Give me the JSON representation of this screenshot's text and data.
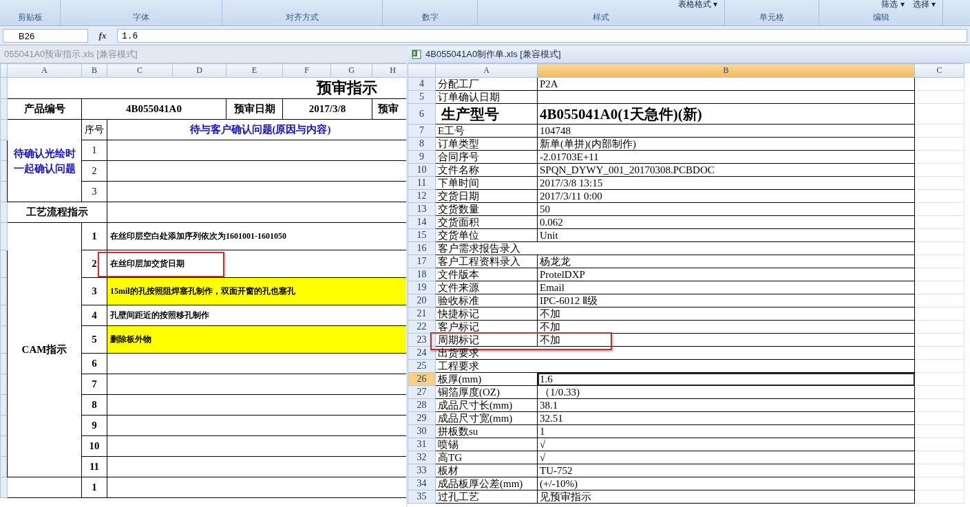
{
  "ribbon": {
    "groups": [
      {
        "label": "剪贴板"
      },
      {
        "label": "字体"
      },
      {
        "label": "对齐方式"
      },
      {
        "label": "数字"
      },
      {
        "label": "样式",
        "commands": [
          "表格格式 ▾"
        ]
      },
      {
        "label": "单元格"
      },
      {
        "label": "编辑",
        "commands": [
          "筛选 ▾",
          "选择 ▾"
        ]
      }
    ]
  },
  "formula_bar": {
    "name_box": "B26",
    "function_label": "fx",
    "value": "1.6"
  },
  "left_window": {
    "title": "055041A0预审指示.xls  [兼容模式]",
    "active": false,
    "columns": [
      "A",
      "B",
      "C",
      "D",
      "E",
      "F",
      "G",
      "H"
    ],
    "sheet_title": "预审指示",
    "info": [
      "产品编号",
      "4B055041A0",
      "预审日期",
      "2017/3/8",
      "预审"
    ],
    "confirm": {
      "label": "待确认光绘时一起确认问题",
      "number_header": "序号",
      "content_header": "待与客户确认问题(原因与内容)",
      "numbers": [
        "1",
        "2",
        "3"
      ]
    },
    "process_label": "工艺流程指示",
    "cam": {
      "label": "CAM指示",
      "rows": [
        {
          "number": "1",
          "text": "在丝印层空白处添加序列依次为1601001-1601050",
          "highlight": false,
          "marked": false
        },
        {
          "number": "2",
          "text": "在丝印层加交货日期",
          "highlight": false,
          "marked": true
        },
        {
          "number": "3",
          "text": "15mil的孔按照阻焊塞孔制作，双面开窗的孔也塞孔",
          "highlight": true,
          "marked": false
        },
        {
          "number": "4",
          "text": "孔壁间距近的按照移孔制作",
          "highlight": false,
          "marked": false
        },
        {
          "number": "5",
          "text": "删除板外物",
          "highlight": true,
          "marked": false
        },
        {
          "number": "6",
          "text": "",
          "highlight": false,
          "marked": false
        },
        {
          "number": "7",
          "text": "",
          "highlight": false,
          "marked": false
        },
        {
          "number": "8",
          "text": "",
          "highlight": false,
          "marked": false
        },
        {
          "number": "9",
          "text": "",
          "highlight": false,
          "marked": false
        },
        {
          "number": "10",
          "text": "",
          "highlight": false,
          "marked": false
        },
        {
          "number": "11",
          "text": "",
          "highlight": false,
          "marked": false
        }
      ]
    },
    "next_numbers": [
      "1"
    ]
  },
  "right_window": {
    "title": "4B055041A0制作单.xls  [兼容模式]",
    "active": true,
    "columns": [
      {
        "label": "A",
        "selected": false
      },
      {
        "label": "B",
        "selected": true
      },
      {
        "label": "C",
        "selected": false
      }
    ],
    "rows": [
      {
        "number": "4",
        "label": "分配工厂",
        "value": "P2A",
        "kind": "pair",
        "selected": false,
        "marked": false
      },
      {
        "number": "5",
        "label": "订单确认日期",
        "value": "",
        "kind": "pair",
        "selected": false,
        "marked": false
      },
      {
        "number": "6",
        "label": "生产型号",
        "value": "4B055041A0(1天急件)(新)",
        "kind": "large",
        "selected": false,
        "marked": false
      },
      {
        "number": "7",
        "label": "E工号",
        "value": "104748",
        "kind": "pair",
        "selected": false,
        "marked": false
      },
      {
        "number": "8",
        "label": "订单类型",
        "value": "新单(单拼)(内部制作)",
        "kind": "pair",
        "selected": false,
        "marked": false
      },
      {
        "number": "9",
        "label": "合同序号",
        "value": "-2.01703E+11",
        "kind": "pair",
        "selected": false,
        "marked": false
      },
      {
        "number": "10",
        "label": "文件名称",
        "value": "SPQN_DYWY_001_20170308.PCBDOC",
        "kind": "pair",
        "selected": false,
        "marked": false
      },
      {
        "number": "11",
        "label": "下单时间",
        "value": "2017/3/8 13:15",
        "kind": "pair",
        "selected": false,
        "marked": false
      },
      {
        "number": "12",
        "label": "交货日期",
        "value": "2017/3/11 0:00",
        "kind": "pair",
        "selected": false,
        "marked": false
      },
      {
        "number": "13",
        "label": "交货数量",
        "value": "50",
        "kind": "pair",
        "selected": false,
        "marked": false
      },
      {
        "number": "14",
        "label": "交货面积",
        "value": "0.062",
        "kind": "pair",
        "selected": false,
        "marked": false
      },
      {
        "number": "15",
        "label": "交货单位",
        "value": "Unit",
        "kind": "pair",
        "selected": false,
        "marked": false
      },
      {
        "number": "16",
        "label": "客户需求报告录入",
        "kind": "merged",
        "selected": false,
        "marked": false
      },
      {
        "number": "17",
        "label": "客户工程资料录入",
        "value": "杨龙龙",
        "kind": "pair",
        "selected": false,
        "marked": false
      },
      {
        "number": "18",
        "label": "文件版本",
        "value": "ProtelDXP",
        "kind": "pair",
        "selected": false,
        "marked": false
      },
      {
        "number": "19",
        "label": "文件来源",
        "value": "Email",
        "kind": "pair",
        "selected": false,
        "marked": false
      },
      {
        "number": "20",
        "label": "验收标准",
        "value": "IPC-6012 Ⅱ级",
        "kind": "pair",
        "selected": false,
        "marked": false
      },
      {
        "number": "21",
        "label": "快捷标记",
        "value": "不加",
        "kind": "pair",
        "selected": false,
        "marked": false
      },
      {
        "number": "22",
        "label": "客户标记",
        "value": "不加",
        "kind": "pair",
        "selected": false,
        "marked": false
      },
      {
        "number": "23",
        "label": "周期标记",
        "value": "不加",
        "kind": "pair",
        "selected": false,
        "marked": true
      },
      {
        "number": "24",
        "label": "出货要求",
        "kind": "merged",
        "selected": false,
        "marked": false
      },
      {
        "number": "25",
        "label": "工程要求",
        "kind": "merged",
        "selected": false,
        "marked": false
      },
      {
        "number": "26",
        "label": "板厚(mm)",
        "value": "1.6",
        "kind": "pair",
        "selected": true,
        "marked": false
      },
      {
        "number": "27",
        "label": "铜箔厚度(OZ)",
        "value": "（1/0.33)",
        "kind": "pair",
        "selected": false,
        "marked": false
      },
      {
        "number": "28",
        "label": "成品尺寸长(mm)",
        "value": "38.1",
        "kind": "pair",
        "selected": false,
        "marked": false
      },
      {
        "number": "29",
        "label": "成品尺寸宽(mm)",
        "value": "32.51",
        "kind": "pair",
        "selected": false,
        "marked": false
      },
      {
        "number": "30",
        "label": "拼板数su",
        "value": "1",
        "kind": "pair",
        "selected": false,
        "marked": false
      },
      {
        "number": "31",
        "label": "喷锡",
        "value": "√",
        "kind": "pair",
        "selected": false,
        "marked": false
      },
      {
        "number": "32",
        "label": "高TG",
        "value": "√",
        "kind": "pair",
        "selected": false,
        "marked": false
      },
      {
        "number": "33",
        "label": "板材",
        "value": "TU-752",
        "kind": "pair",
        "selected": false,
        "marked": false
      },
      {
        "number": "34",
        "label": "成品板厚公差(mm)",
        "value": "(+/-10%)",
        "kind": "pair",
        "selected": false,
        "marked": false
      },
      {
        "number": "35",
        "label": "过孔工艺",
        "value": "见预审指示",
        "kind": "pair",
        "selected": false,
        "marked": false
      }
    ]
  }
}
